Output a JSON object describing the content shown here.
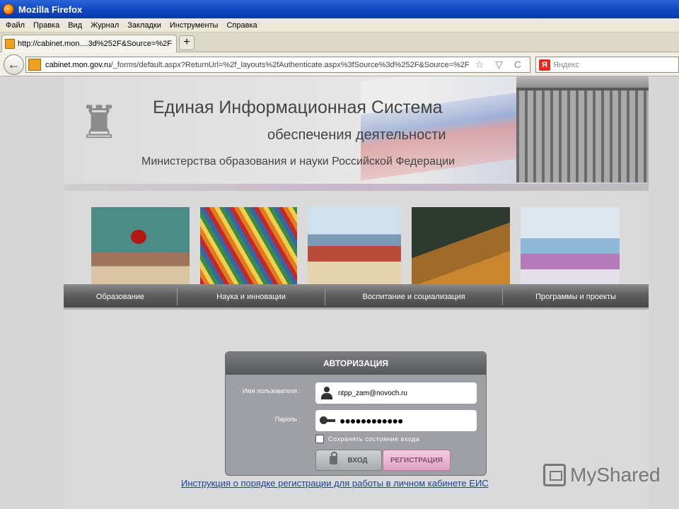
{
  "window": {
    "title": "Mozilla Firefox"
  },
  "menu": [
    "Файл",
    "Правка",
    "Вид",
    "Журнал",
    "Закладки",
    "Инструменты",
    "Справка"
  ],
  "tab": {
    "label": "http://cabinet.mon....3d%252F&Source=%2F",
    "new_tab_label": "+"
  },
  "nav": {
    "back_label": "←",
    "url_host": "cabinet.mon.gov.ru",
    "url_path": "/_forms/default.aspx?ReturnUrl=%2f_layouts%2fAuthenticate.aspx%3fSource%3d%252F&Source=%2F",
    "url_controls": "☆ ▽ C",
    "search_engine_letter": "Я",
    "search_placeholder": "Яндекс"
  },
  "header": {
    "emblem_glyph": "♜",
    "title_line1": "Единая Информационная Система",
    "title_line2": "обеспечения деятельности",
    "title_line3": "Министерства образования и науки Российской Федерации"
  },
  "navmenu": [
    "Образование",
    "Наука и инновации",
    "Воспитание и социализация",
    "Программы и проекты"
  ],
  "login": {
    "heading": "АВТОРИЗАЦИЯ",
    "username_label": "Имя пользователя :",
    "username_value": "ntpp_zam@novoch.ru",
    "password_label": "Пароль :",
    "password_value": "●●●●●●●●●●●●",
    "remember_label": "Сохранять состояние входа",
    "login_button": "ВХОД",
    "register_button": "РЕГИСТРАЦИЯ"
  },
  "instruction_link": "Инструкция о порядке регистрации для работы в личном кабинете ЕИС",
  "watermark": "MyShared"
}
